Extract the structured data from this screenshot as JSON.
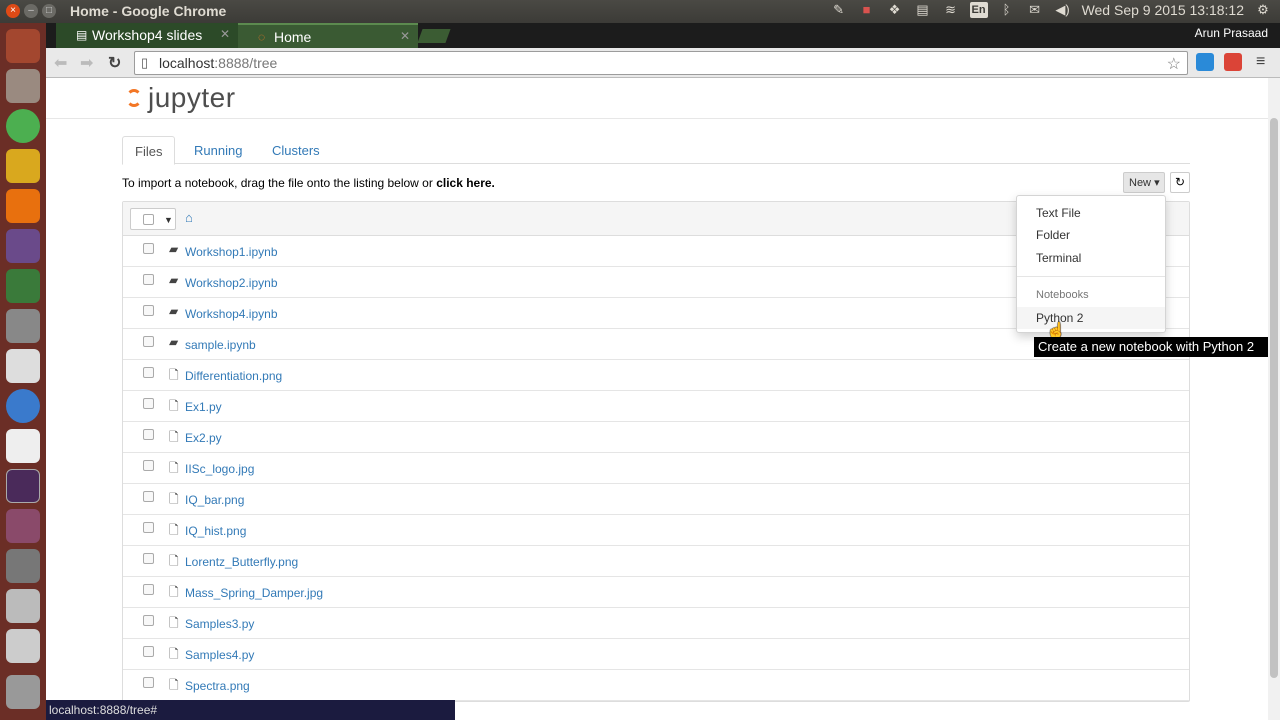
{
  "window": {
    "title": "Home - Google Chrome"
  },
  "top_panel": {
    "keyboard_layout": "En",
    "clock": "Wed Sep  9 2015 13:18:12"
  },
  "browser": {
    "tabs": [
      {
        "label": "Workshop4 slides"
      },
      {
        "label": "Home"
      }
    ],
    "user": "Arun Prasaad",
    "url_host": "localhost",
    "url_rest": ":8888/tree"
  },
  "jupyter": {
    "logo_text": "jupyter",
    "tabs": [
      "Files",
      "Running",
      "Clusters"
    ],
    "import_text": "To import a notebook, drag the file onto the listing below or ",
    "click_here": "click here.",
    "new_button": "New",
    "files": [
      {
        "name": "Workshop1.ipynb",
        "icon": "notebook-icon"
      },
      {
        "name": "Workshop2.ipynb",
        "icon": "notebook-icon"
      },
      {
        "name": "Workshop4.ipynb",
        "icon": "notebook-icon"
      },
      {
        "name": "sample.ipynb",
        "icon": "notebook-icon"
      },
      {
        "name": "Differentiation.png",
        "icon": "file-icon"
      },
      {
        "name": "Ex1.py",
        "icon": "file-icon"
      },
      {
        "name": "Ex2.py",
        "icon": "file-icon"
      },
      {
        "name": "IISc_logo.jpg",
        "icon": "file-icon"
      },
      {
        "name": "IQ_bar.png",
        "icon": "file-icon"
      },
      {
        "name": "IQ_hist.png",
        "icon": "file-icon"
      },
      {
        "name": "Lorentz_Butterfly.png",
        "icon": "file-icon"
      },
      {
        "name": "Mass_Spring_Damper.jpg",
        "icon": "file-icon"
      },
      {
        "name": "Samples3.py",
        "icon": "file-icon"
      },
      {
        "name": "Samples4.py",
        "icon": "file-icon"
      },
      {
        "name": "Spectra.png",
        "icon": "file-icon"
      }
    ],
    "new_menu": {
      "items": [
        "Text File",
        "Folder",
        "Terminal"
      ],
      "notebooks_header": "Notebooks",
      "notebooks": [
        "Python 2"
      ]
    },
    "tooltip": "Create a new notebook with Python 2"
  },
  "status_bar": "localhost:8888/tree#",
  "colors": {
    "link": "#337ab7",
    "launcher": "#6b2e26",
    "jupyter_orange": "#f37726"
  }
}
